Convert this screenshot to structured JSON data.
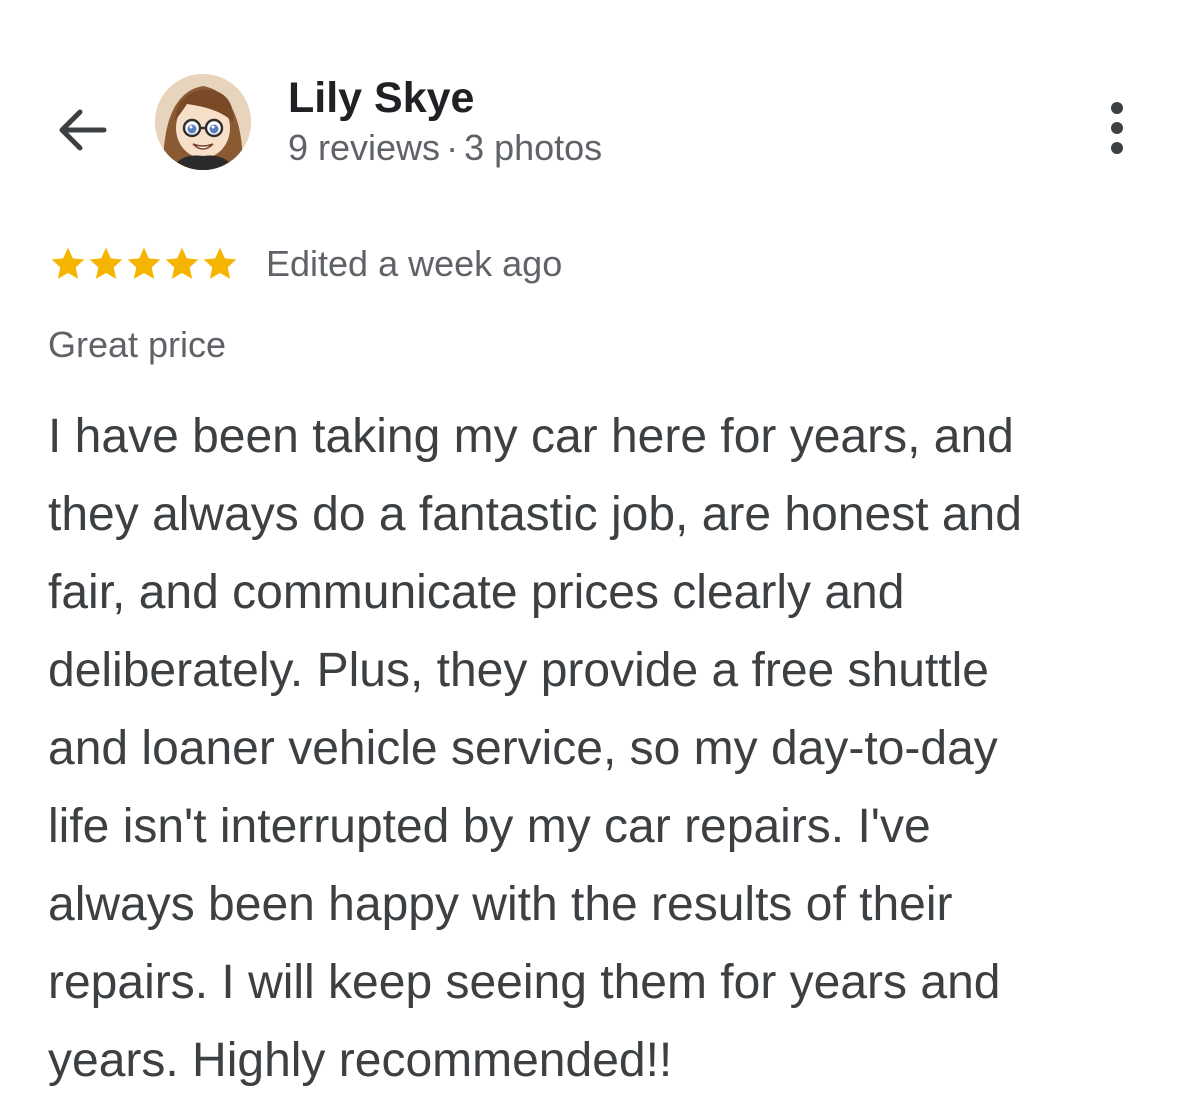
{
  "reviewer": {
    "name": "Lily Skye",
    "reviews": "9 reviews",
    "separator": "·",
    "photos": "3 photos"
  },
  "rating": {
    "stars": 5,
    "max": 5,
    "star_color": "#f4b400",
    "edited": "Edited a week ago"
  },
  "tag": "Great price",
  "review_lines": [
    "I have been taking my car here for years, and",
    "they always do a fantastic job, are honest and",
    "fair, and communicate prices clearly and",
    "deliberately. Plus, they provide a free shuttle",
    "and loaner vehicle service, so my day-to-day",
    "life isn't interrupted by my car repairs. I've",
    "always been happy with the results of their",
    "repairs. I will keep seeing them for years and",
    "years. Highly recommended!!"
  ],
  "icons": {
    "back": "arrow-left-icon",
    "more": "more-vertical-icon",
    "star": "star-icon"
  }
}
